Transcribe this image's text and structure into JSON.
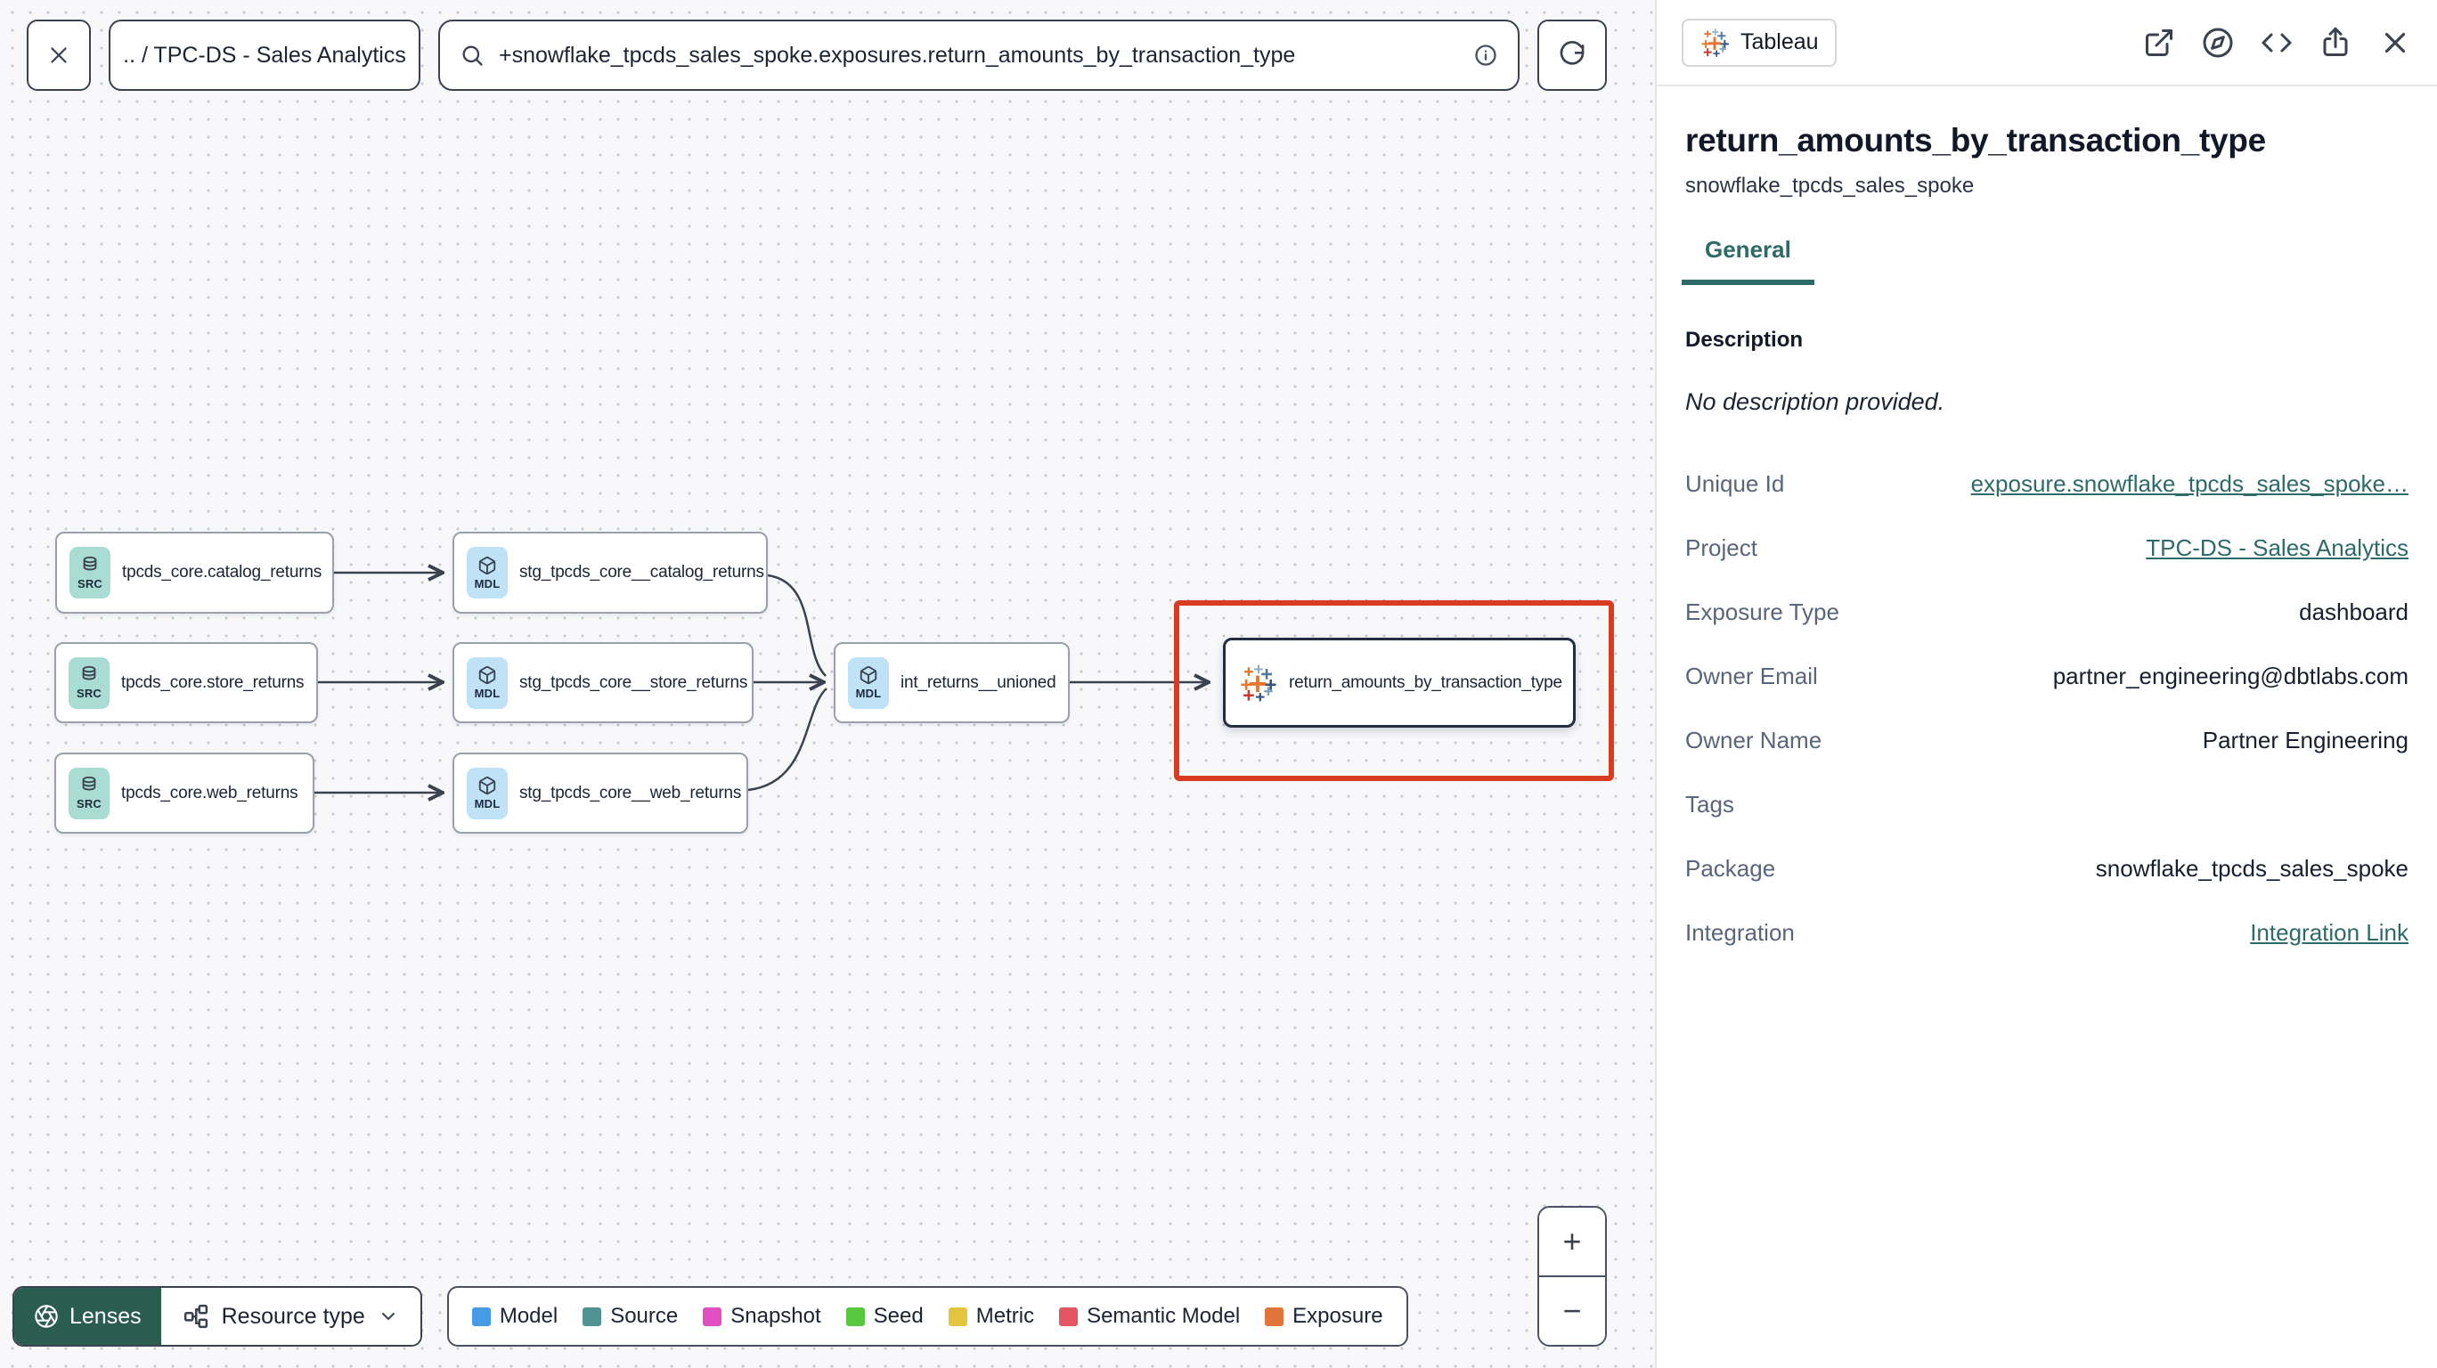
{
  "colors": {
    "accent_teal": "#2d6a68",
    "highlight_red": "#d93b20",
    "lenses_green": "#2b5c50",
    "src_badge": "#a9ddd3",
    "mdl_badge": "#bfe2f7"
  },
  "topbar": {
    "breadcrumb": ".. / TPC-DS - Sales Analytics",
    "search_value": "+snowflake_tpcds_sales_spoke.exposures.return_amounts_by_transaction_type"
  },
  "graph": {
    "nodes": [
      {
        "badge": "SRC",
        "label": "tpcds_core.catalog_returns"
      },
      {
        "badge": "MDL",
        "label": "stg_tpcds_core__catalog_returns"
      },
      {
        "badge": "SRC",
        "label": "tpcds_core.store_returns"
      },
      {
        "badge": "MDL",
        "label": "stg_tpcds_core__store_returns"
      },
      {
        "badge": "MDL",
        "label": "int_returns__unioned"
      },
      {
        "badge": "SRC",
        "label": "tpcds_core.web_returns"
      },
      {
        "badge": "MDL",
        "label": "stg_tpcds_core__web_returns"
      },
      {
        "badge": "",
        "label": "return_amounts_by_transaction_type"
      }
    ]
  },
  "toolbar": {
    "lenses": "Lenses",
    "resource_type": "Resource type"
  },
  "legend": {
    "items": [
      {
        "label": "Model",
        "color": "#459be6"
      },
      {
        "label": "Source",
        "color": "#4f9394"
      },
      {
        "label": "Snapshot",
        "color": "#e14ec2"
      },
      {
        "label": "Seed",
        "color": "#58c740"
      },
      {
        "label": "Metric",
        "color": "#e4c53f"
      },
      {
        "label": "Semantic Model",
        "color": "#e25663"
      },
      {
        "label": "Exposure",
        "color": "#e0753c"
      }
    ]
  },
  "zoom_controls": {
    "in": "+",
    "out": "−"
  },
  "panel": {
    "integration": "Tableau",
    "title": "return_amounts_by_transaction_type",
    "subtitle": "snowflake_tpcds_sales_spoke",
    "tab": "General",
    "description_label": "Description",
    "description_value": "No description provided.",
    "fields": [
      {
        "label": "Unique Id",
        "value": "exposure.snowflake_tpcds_sales_spoke…"
      },
      {
        "label": "Project",
        "value": "TPC-DS - Sales Analytics"
      },
      {
        "label": "Exposure Type",
        "value": "dashboard"
      },
      {
        "label": "Owner Email",
        "value": "partner_engineering@dbtlabs.com"
      },
      {
        "label": "Owner Name",
        "value": "Partner Engineering"
      },
      {
        "label": "Tags",
        "value": ""
      },
      {
        "label": "Package",
        "value": "snowflake_tpcds_sales_spoke"
      },
      {
        "label": "Integration",
        "value": "Integration Link"
      }
    ]
  }
}
